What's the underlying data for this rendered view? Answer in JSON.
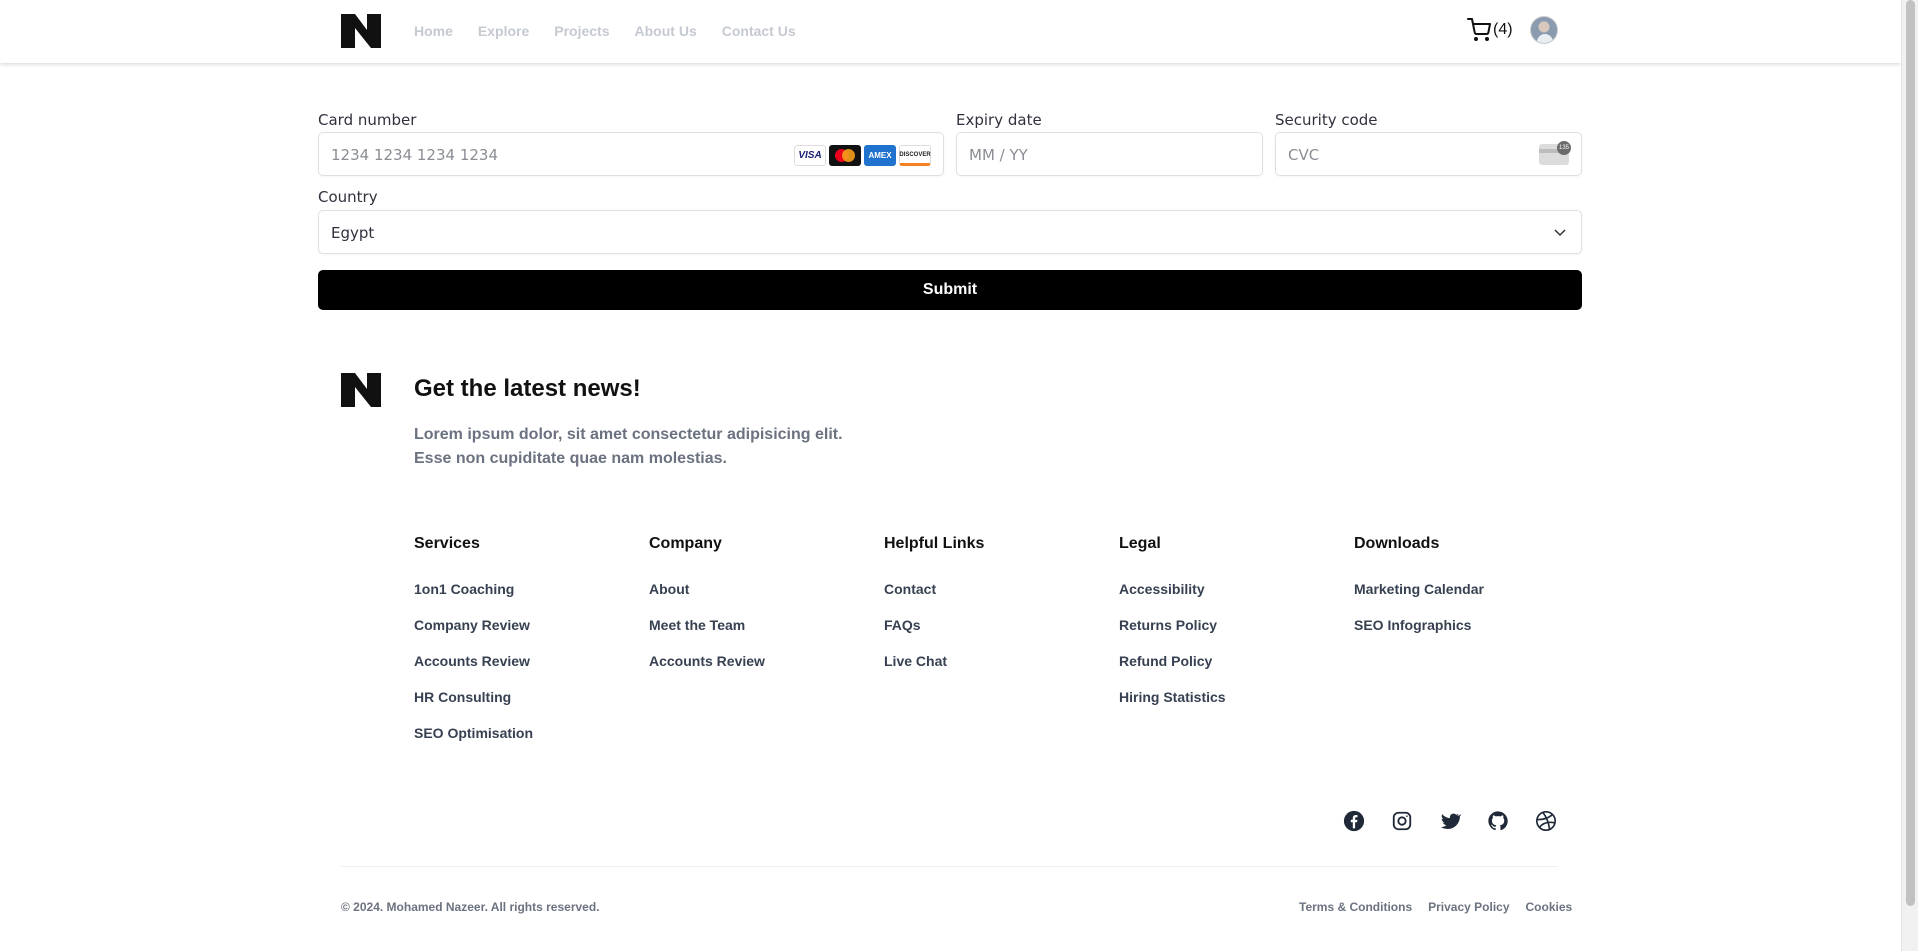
{
  "header": {
    "logo_label": "N",
    "nav": [
      "Home",
      "Explore",
      "Projects",
      "About Us",
      "Contact Us"
    ],
    "cart_count": "(4)"
  },
  "payment_form": {
    "card_number": {
      "label": "Card number",
      "placeholder": "1234 1234 1234 1234"
    },
    "card_brands": [
      "VISA",
      "Mastercard",
      "AMEX",
      "DISCOVER"
    ],
    "expiry": {
      "label": "Expiry date",
      "placeholder": "MM / YY"
    },
    "security_code": {
      "label": "Security code",
      "placeholder": "CVC",
      "icon_text": "135"
    },
    "country": {
      "label": "Country",
      "value": "Egypt"
    },
    "submit_label": "Submit"
  },
  "newsletter": {
    "title": "Get the latest news!",
    "line1": "Lorem ipsum dolor, sit amet consectetur adipisicing elit.",
    "line2": "Esse non cupiditate quae nam molestias."
  },
  "footer": {
    "columns": [
      {
        "heading": "Services",
        "links": [
          "1on1 Coaching",
          "Company Review",
          "Accounts Review",
          "HR Consulting",
          "SEO Optimisation"
        ]
      },
      {
        "heading": "Company",
        "links": [
          "About",
          "Meet the Team",
          "Accounts Review"
        ]
      },
      {
        "heading": "Helpful Links",
        "links": [
          "Contact",
          "FAQs",
          "Live Chat"
        ]
      },
      {
        "heading": "Legal",
        "links": [
          "Accessibility",
          "Returns Policy",
          "Refund Policy",
          "Hiring Statistics"
        ]
      },
      {
        "heading": "Downloads",
        "links": [
          "Marketing Calendar",
          "SEO Infographics"
        ]
      }
    ],
    "social_icons": [
      "facebook-icon",
      "instagram-icon",
      "twitter-icon",
      "github-icon",
      "dribbble-icon"
    ],
    "copyright": "© 2024. Mohamed Nazeer. All rights reserved.",
    "legal_links": [
      "Terms & Conditions",
      "Privacy Policy",
      "Cookies"
    ]
  },
  "colors": {
    "nav_text": "#c5c9d0",
    "primary_button": "#000000",
    "muted_text": "#6b7280"
  }
}
